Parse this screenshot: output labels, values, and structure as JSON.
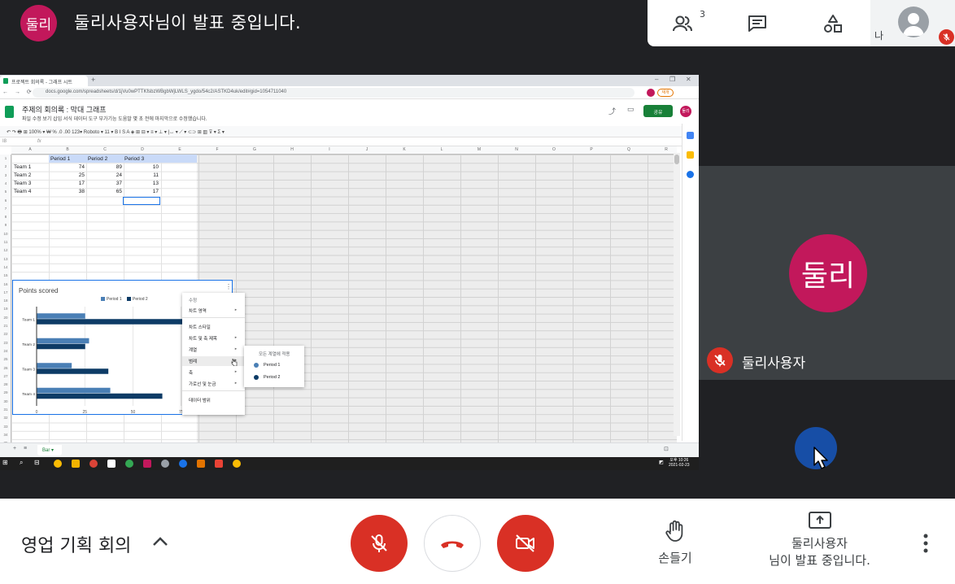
{
  "top_bar": {
    "presenter_badge": "둘리",
    "presenting_text": "둘리사용자님이 발표 중입니다.",
    "participants_count": "3",
    "self_label": "나"
  },
  "shared_screen": {
    "browser_tab_title": "프로젝트 회의록 - 그래프 시트",
    "url": "docs.google.com/spreadsheets/d/1jVu0wPTTKfsbzWBgbWjLWLS_ygdo/54c2/ASTKD4uk/edit#gid=1054711040",
    "resume_label": "재개",
    "doc_title": "주제의 회의록 : 막대 그래프",
    "doc_menu": "파일 수정 보기 삽입 서식 데이터 도구 부가기능 도움말   몇 초 전에 마지막으로 수정했습니다.",
    "share_label": "공유",
    "doc_avatar": "둘리",
    "toolbar_text": "↶ ↷ 🖶 ⊞   100% ▾   ₩  %  .0  .00  123▾   Roboto  ▾   11  ▾   B  I  S  A   ◈  ⊞  ⊟ ▾   ≡ ▾  ⊥ ▾  |↔ ▾  ⟋ ▾   ⊂⊃  ⊞  ▥  ⊽ ▾  Σ ▾",
    "cell_ref": "I8",
    "fx": "fx",
    "columns": [
      "A",
      "B",
      "C",
      "D",
      "E",
      "F",
      "G",
      "H",
      "I",
      "J",
      "K",
      "L",
      "M",
      "N",
      "O",
      "P",
      "Q",
      "R"
    ],
    "table_header": [
      "",
      "Period 1",
      "Period 2",
      "Period 3"
    ],
    "table_rows": [
      [
        "Team 1",
        "74",
        "89",
        "10"
      ],
      [
        "Team 2",
        "25",
        "24",
        "11"
      ],
      [
        "Team 3",
        "17",
        "37",
        "13"
      ],
      [
        "Team 4",
        "38",
        "65",
        "17"
      ]
    ],
    "sheet_tab": "Bar",
    "context_menu": {
      "header": "수정",
      "items": [
        "차트 영역",
        "차트 스타일",
        "차트 및 축 제목",
        "계열",
        "범례",
        "축",
        "가로선 및 눈금",
        "데이터 범위"
      ],
      "highlighted": "범례"
    },
    "submenu": {
      "header": "모든 계열에 적용",
      "items": [
        "Period 1",
        "Period 2"
      ]
    },
    "clock": {
      "time": "오후 10:26",
      "date": "2021-02-23"
    }
  },
  "chart_data": {
    "type": "bar",
    "orientation": "horizontal",
    "title": "Points scored",
    "categories": [
      "Team 1",
      "Team 2",
      "Team 3",
      "Team 4"
    ],
    "series": [
      {
        "name": "Period 1",
        "values": [
          25,
          27,
          18,
          38
        ],
        "color": "#4a7fb5"
      },
      {
        "name": "Period 2",
        "values": [
          80,
          25,
          37,
          65
        ],
        "color": "#0d3b66"
      }
    ],
    "xticks": [
      "0",
      "25",
      "50",
      "75"
    ],
    "xlim": [
      0,
      100
    ],
    "legend_position": "top"
  },
  "participant": {
    "avatar": "둘리",
    "name": "둘리사용자"
  },
  "bottom_bar": {
    "meeting_title": "영업 기획 회의",
    "raise_hand_label": "손들기",
    "present_line1": "둘리사용자",
    "present_line2": "님이 발표 중입니다."
  },
  "colors": {
    "accent_red": "#d93025",
    "avatar_pink": "#c2185b",
    "self_view_blue": "#174ea6",
    "background": "#202124"
  }
}
